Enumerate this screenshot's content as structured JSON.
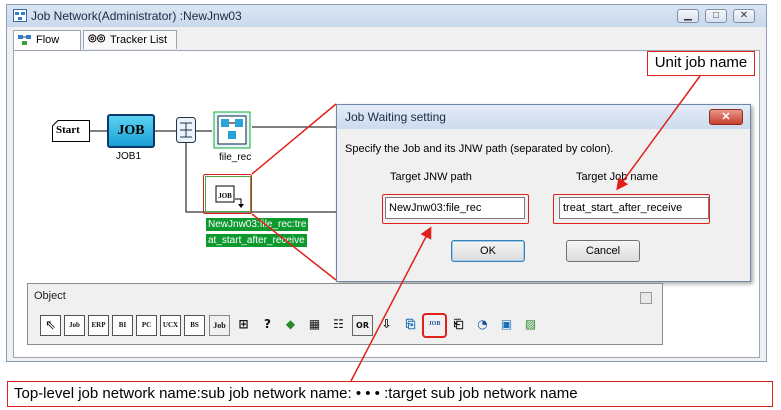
{
  "window": {
    "title": "Job Network(Administrator) :NewJnw03",
    "buttons": [
      "minimize",
      "maximize",
      "close"
    ]
  },
  "tabs": [
    {
      "label": "Flow",
      "icon": "flow-icon",
      "active": true
    },
    {
      "label": "Tracker List",
      "icon": "tracker-icon",
      "active": false
    }
  ],
  "flow": {
    "start_label": "Start",
    "job_text": "JOB",
    "job_name": "JOB1",
    "receive_name": "file_rec",
    "wait_name_line1": "NewJnw03:file_rec:tre",
    "wait_name_line2": "at_start_after_receive"
  },
  "dialog": {
    "title": "Job Waiting setting",
    "instruction": "Specify the Job and its JNW path (separated by colon).",
    "jnw_header": "Target JNW path",
    "job_header": "Target Job name",
    "jnw_value": "NewJnw03:file_rec",
    "separator": ":",
    "job_value": "treat_start_after_receive",
    "ok_label": "OK",
    "cancel_label": "Cancel"
  },
  "palette": {
    "title": "Object",
    "tools": [
      {
        "name": "pointer-tool",
        "text": "",
        "icon": "pointer-icon"
      },
      {
        "name": "job-tool",
        "text": "Job"
      },
      {
        "name": "erp-tool",
        "text": "ERP"
      },
      {
        "name": "bi-tool",
        "text": "BI"
      },
      {
        "name": "pc-tool",
        "text": "PC"
      },
      {
        "name": "ucx-tool",
        "text": "UCX"
      },
      {
        "name": "bs-tool",
        "text": "BS"
      },
      {
        "name": "job-group-tool",
        "text": "Job"
      },
      {
        "name": "sub-jnw-tool",
        "text": "",
        "icon": "subnetwork-icon"
      },
      {
        "name": "condition-tool",
        "text": "?",
        "icon": "question-icon"
      },
      {
        "name": "jump-tool",
        "text": "",
        "icon": "diamond-arrow-icon"
      },
      {
        "name": "calendar-tool",
        "text": "",
        "icon": "calendar-icon"
      },
      {
        "name": "parallel-tool",
        "text": "",
        "icon": "parallel-icon"
      },
      {
        "name": "or-tool",
        "text": "OR",
        "icon": "or-branch-icon"
      },
      {
        "name": "arrow-tool",
        "text": "⇩",
        "icon": "down-arrow-icon"
      },
      {
        "name": "event-send-tool",
        "text": "",
        "icon": "event-send-icon"
      },
      {
        "name": "job-wait-tool",
        "text": "JOB",
        "icon": "job-wait-icon",
        "highlighted": true
      },
      {
        "name": "file-wait-tool",
        "text": "",
        "icon": "file-wait-icon"
      },
      {
        "name": "time-wait-tool",
        "text": "",
        "icon": "clock-wait-icon"
      },
      {
        "name": "event-tool",
        "text": "",
        "icon": "event-icon"
      },
      {
        "name": "dialog-tool",
        "text": "",
        "icon": "dialog-icon"
      }
    ]
  },
  "annotations": {
    "unit_job": "Unit job name",
    "path_format": "Top-level job network name:sub job network name: • • • :target sub job network name"
  },
  "colors": {
    "highlight": "#e0201a",
    "selection": "#0c9a2e",
    "job_fill": "#1a9fd6"
  }
}
